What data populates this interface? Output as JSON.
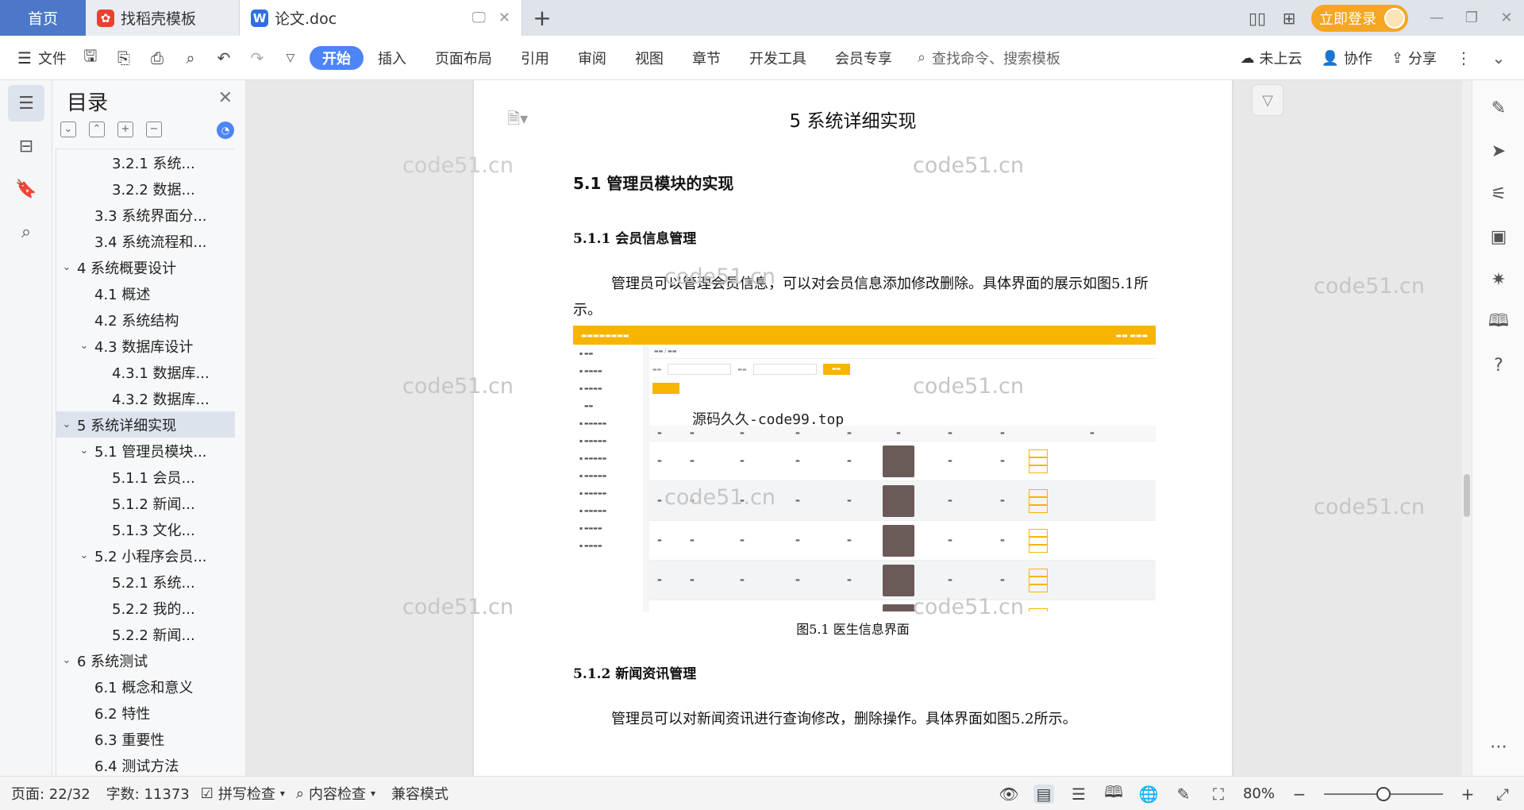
{
  "titlebar": {
    "home_tab": "首页",
    "tabs": [
      {
        "label": "找稻壳模板"
      },
      {
        "label": "论文.doc"
      }
    ],
    "login_button": "立即登录"
  },
  "toolbar": {
    "file_menu": "文件",
    "ribbon_tabs": [
      "开始",
      "插入",
      "页面布局",
      "引用",
      "审阅",
      "视图",
      "章节",
      "开发工具",
      "会员专享"
    ],
    "active_tab": "开始",
    "search_placeholder": "查找命令、搜索模板",
    "cloud_status": "未上云",
    "collab": "协作",
    "share": "分享"
  },
  "toc": {
    "title": "目录",
    "items": [
      {
        "label": "3.2.1 系统...",
        "level": 3
      },
      {
        "label": "3.2.2 数据...",
        "level": 3
      },
      {
        "label": "3.3 系统界面分...",
        "level": 2
      },
      {
        "label": "3.4 系统流程和...",
        "level": 2
      },
      {
        "label": "4 系统概要设计",
        "level": 1,
        "expanded": true
      },
      {
        "label": "4.1 概述",
        "level": 2
      },
      {
        "label": "4.2 系统结构",
        "level": 2
      },
      {
        "label": "4.3 数据库设计",
        "level": 2,
        "expanded": true
      },
      {
        "label": "4.3.1 数据库...",
        "level": 3
      },
      {
        "label": "4.3.2 数据库...",
        "level": 3
      },
      {
        "label": "5 系统详细实现",
        "level": 1,
        "expanded": true,
        "active": true
      },
      {
        "label": "5.1 管理员模块...",
        "level": 2,
        "expanded": true
      },
      {
        "label": "5.1.1 会员...",
        "level": 3
      },
      {
        "label": "5.1.2 新闻...",
        "level": 3
      },
      {
        "label": "5.1.3 文化...",
        "level": 3
      },
      {
        "label": "5.2 小程序会员...",
        "level": 2,
        "expanded": true
      },
      {
        "label": "5.2.1 系统...",
        "level": 3
      },
      {
        "label": "5.2.2 我的...",
        "level": 3
      },
      {
        "label": "5.2.2 新闻...",
        "level": 3
      },
      {
        "label": "6 系统测试",
        "level": 1,
        "expanded": true
      },
      {
        "label": "6.1 概念和意义",
        "level": 2
      },
      {
        "label": "6.2 特性",
        "level": 2
      },
      {
        "label": "6.3 重要性",
        "level": 2
      },
      {
        "label": "6.4 测试方法",
        "level": 2
      }
    ]
  },
  "document": {
    "chapter_title": "5 系统详细实现",
    "section_title": "5.1  管理员模块的实现",
    "sub1_title": "5.1.1  会员信息管理",
    "para1": "管理员可以管理会员信息，可以对会员信息添加修改删除。具体界面的展示如图5.1所示。",
    "figure_caption": "图5.1  医生信息界面",
    "sub2_title": "5.1.2  新闻资讯管理",
    "para2": "管理员可以对新闻资讯进行查询修改，删除操作。具体界面如图5.2所示。",
    "screenshot_watermark": "源码久久-code99.top",
    "watermark": "code51.cn"
  },
  "statusbar": {
    "page": "页面: 22/32",
    "wordcount": "字数: 11373",
    "spellcheck": "拼写检查",
    "contentcheck": "内容检查",
    "compat": "兼容模式",
    "zoom": "80%",
    "zoom_level": 0.5
  },
  "colors": {
    "accent": "#4d84f7",
    "home_tab": "#4d78c9",
    "login": "#f5a623",
    "shot_header": "#f7b500"
  }
}
